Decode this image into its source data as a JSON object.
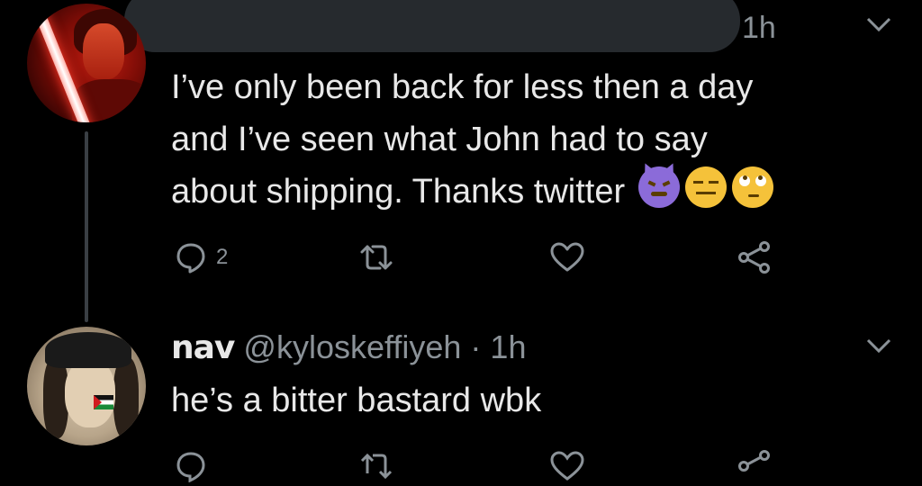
{
  "tweet": {
    "time_fragment": "1h",
    "text_lines": [
      "I’ve only been back for less then a day",
      "and I’ve seen what John had to say",
      "about shipping. Thanks twitter"
    ],
    "emojis": [
      "smiling-imp-icon",
      "expressionless-face-icon",
      "face-with-rolling-eyes-icon"
    ],
    "actions": {
      "reply_count": "2",
      "retweet_count": "",
      "like_count": "",
      "icons": [
        "reply-icon",
        "retweet-icon",
        "heart-icon",
        "share-icon"
      ]
    }
  },
  "reply": {
    "display_name": "nav",
    "handle": "@kyloskeffiyeh",
    "separator": "·",
    "time": "1h",
    "text": "he’s a bitter bastard wbk"
  },
  "colors": {
    "background": "#000000",
    "text": "#e8e8e8",
    "muted": "#8b9298",
    "thread_line": "#3a3f44"
  }
}
